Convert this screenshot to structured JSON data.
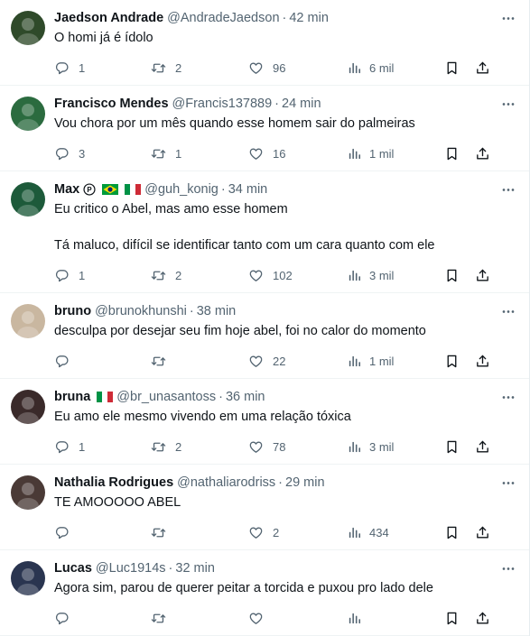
{
  "tweets": [
    {
      "name": "Jaedson Andrade",
      "handle": "@AndradeJaedson",
      "time": "42 min",
      "text": "O homi já é ídolo",
      "replies": "1",
      "retweets": "2",
      "likes": "96",
      "views": "6 mil",
      "avatar_color": "#2f4a2a",
      "badges": []
    },
    {
      "name": "Francisco Mendes",
      "handle": "@Francis137889",
      "time": "24 min",
      "text": "Vou chora por um mês quando esse homem sair do palmeiras",
      "replies": "3",
      "retweets": "1",
      "likes": "16",
      "views": "1 mil",
      "avatar_color": "#2b6b3f",
      "badges": []
    },
    {
      "name": "Max",
      "handle": "@guh_konig",
      "time": "34 min",
      "text": "Eu critico o Abel, mas amo esse homem\n\nTá maluco, difícil se identificar tanto com um cara quanto com ele",
      "replies": "1",
      "retweets": "2",
      "likes": "102",
      "views": "3 mil",
      "avatar_color": "#1d5a3a",
      "badges": [
        "p-icon",
        "brazil-flag",
        "italy-flag"
      ]
    },
    {
      "name": "bruno",
      "handle": "@brunokhunshi",
      "time": "38 min",
      "text": "desculpa por desejar seu fim hoje abel, foi no calor do momento",
      "replies": "",
      "retweets": "",
      "likes": "22",
      "views": "1 mil",
      "avatar_color": "#c9b7a0",
      "badges": []
    },
    {
      "name": "bruna",
      "handle": "@br_unasantoss",
      "time": "36 min",
      "text": "Eu amo ele mesmo vivendo em uma relação tóxica",
      "replies": "1",
      "retweets": "2",
      "likes": "78",
      "views": "3 mil",
      "avatar_color": "#3a2a2a",
      "badges": [
        "italy-flag"
      ]
    },
    {
      "name": "Nathalia Rodrigues",
      "handle": "@nathaliarodriss",
      "time": "29 min",
      "text": "TE AMOOOOO ABEL",
      "replies": "",
      "retweets": "",
      "likes": "2",
      "views": "434",
      "avatar_color": "#4a3a36",
      "badges": []
    },
    {
      "name": "Lucas",
      "handle": "@Luc1914s",
      "time": "32 min",
      "text": "Agora sim, parou de querer peitar a torcida e puxou pro lado dele",
      "replies": "",
      "retweets": "",
      "likes": "",
      "views": "",
      "avatar_color": "#2a3550",
      "badges": []
    }
  ],
  "colors": {
    "text": "#0f1419",
    "muted": "#536471",
    "divider": "#eff3f4"
  }
}
